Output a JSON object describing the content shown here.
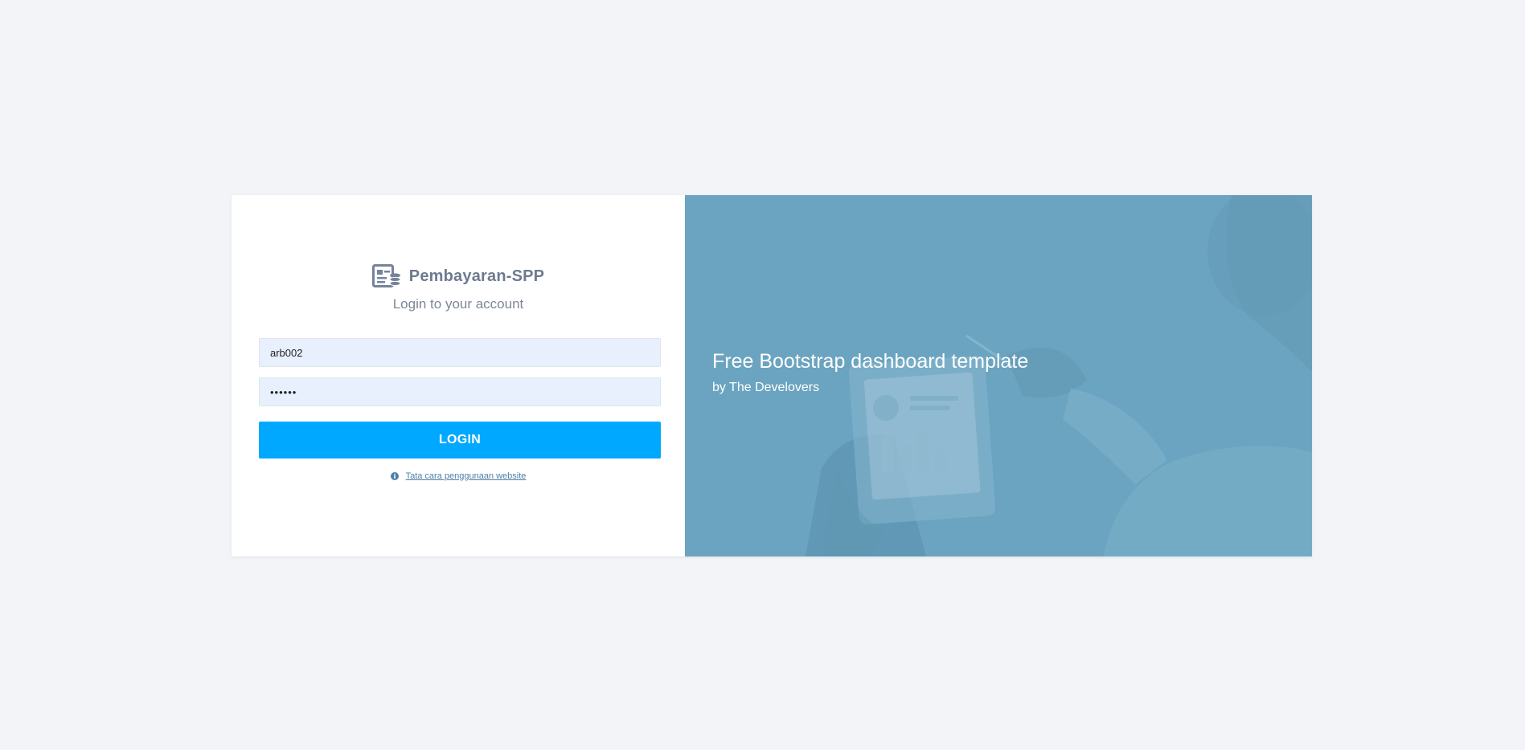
{
  "brand": {
    "name": "Pembayaran-SPP",
    "logo_icon": "invoice-coins-icon"
  },
  "login": {
    "subtitle": "Login to your account",
    "username": {
      "value": "arb002"
    },
    "password": {
      "value": "••••••"
    },
    "button_label": "LOGIN",
    "help_icon": "info-circle-icon",
    "help_link": "Tata cara penggunaan website"
  },
  "hero": {
    "title": "Free Bootstrap dashboard template",
    "subtitle": "by The Develovers"
  },
  "colors": {
    "page_background": "#f2f4f8",
    "accent": "#00a8ff",
    "hero_overlay": "#6ba4c0",
    "input_background": "#e8f0fe"
  }
}
